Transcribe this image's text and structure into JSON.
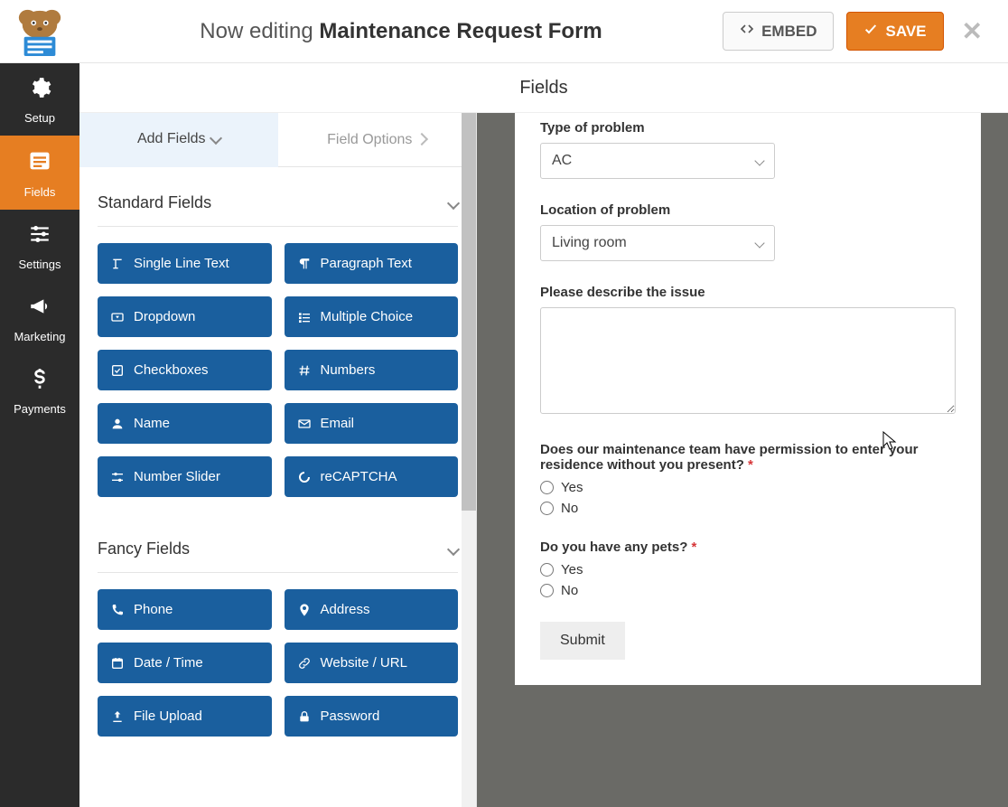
{
  "topbar": {
    "editing_prefix": "Now editing ",
    "form_title": "Maintenance Request Form",
    "embed_label": "EMBED",
    "save_label": "SAVE"
  },
  "sidenav": {
    "setup": "Setup",
    "fields": "Fields",
    "settings": "Settings",
    "marketing": "Marketing",
    "payments": "Payments"
  },
  "ws_header": "Fields",
  "left": {
    "tab_add": "Add Fields",
    "tab_options": "Field Options",
    "standard_title": "Standard Fields",
    "fancy_title": "Fancy Fields",
    "standard": [
      "Single Line Text",
      "Paragraph Text",
      "Dropdown",
      "Multiple Choice",
      "Checkboxes",
      "Numbers",
      "Name",
      "Email",
      "Number Slider",
      "reCAPTCHA"
    ],
    "fancy": [
      "Phone",
      "Address",
      "Date / Time",
      "Website / URL",
      "File Upload",
      "Password"
    ]
  },
  "form": {
    "type_label": "Type of problem",
    "type_value": "AC",
    "location_label": "Location of problem",
    "location_value": "Living room",
    "desc_label": "Please describe the issue",
    "perm_label": "Does our maintenance team have permission to enter your residence without you present?",
    "pets_label": "Do you have any pets?",
    "opt_yes": "Yes",
    "opt_no": "No",
    "submit": "Submit"
  }
}
